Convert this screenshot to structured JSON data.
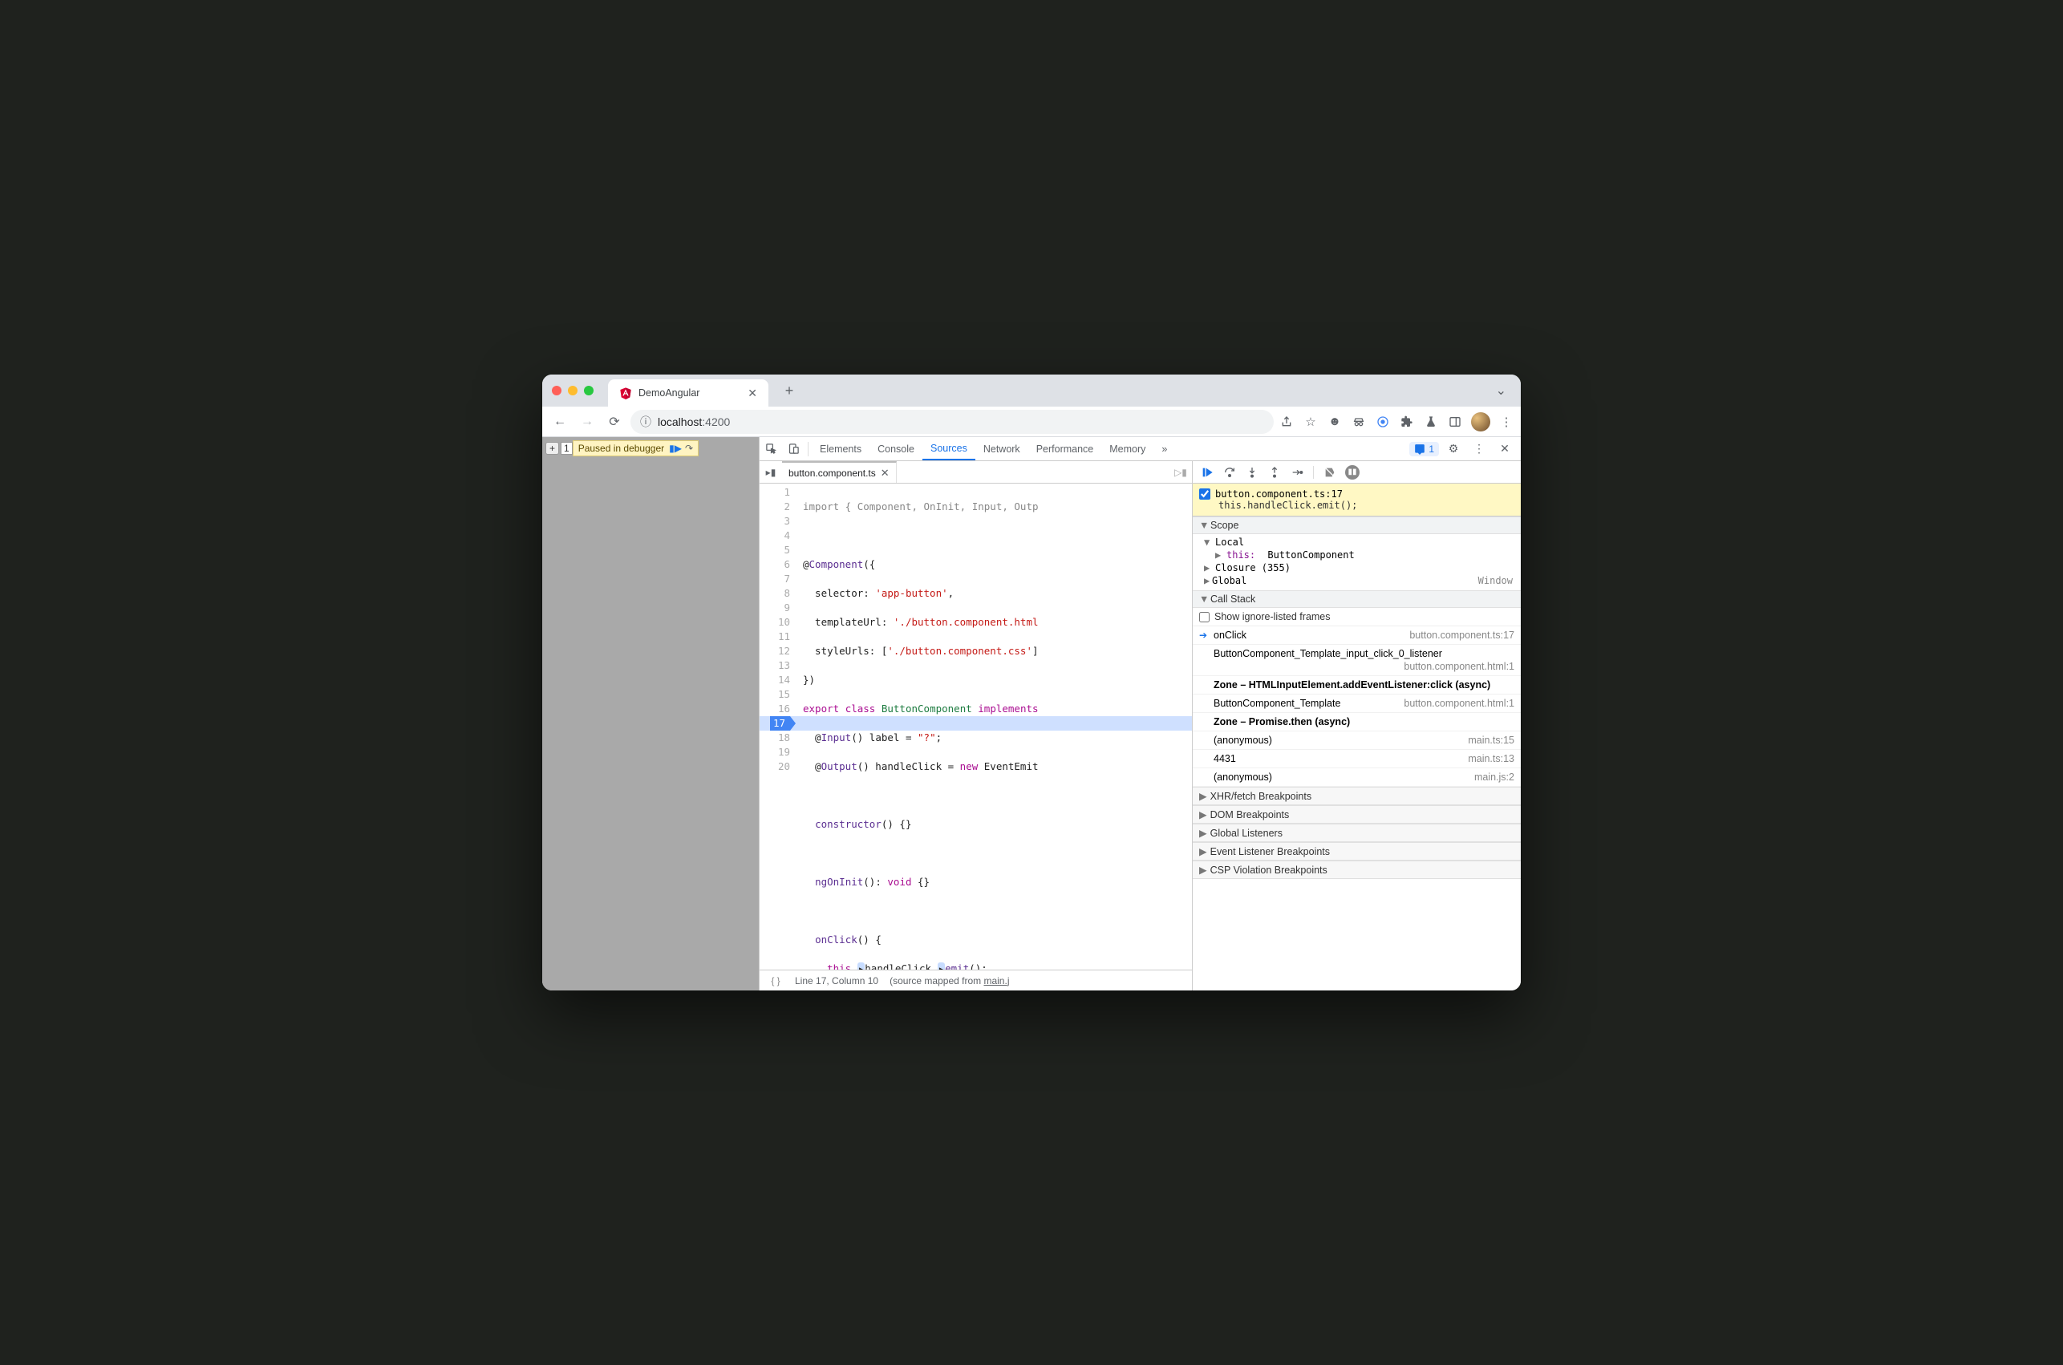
{
  "titlebar": {
    "tab_title": "DemoAngular"
  },
  "toolbar": {
    "url_host": "localhost",
    "url_port": ":4200"
  },
  "paused": {
    "label": "Paused in debugger"
  },
  "devtools_tabs": {
    "elements": "Elements",
    "console": "Console",
    "sources": "Sources",
    "network": "Network",
    "performance": "Performance",
    "memory": "Memory",
    "more": "»",
    "issues_count": "1"
  },
  "file_tab": {
    "name": "button.component.ts"
  },
  "code": {
    "lines": [
      "",
      "",
      "@Component({",
      "  selector: 'app-button',",
      "  templateUrl: './button.component.html",
      "  styleUrls: ['./button.component.css']",
      "})",
      "export class ButtonComponent implements",
      "  @Input() label = \"?\";",
      "  @Output() handleClick = new EventEmit",
      "",
      "  constructor() {}",
      "",
      "  ngOnInit(): void {}",
      "",
      "  onClick() {",
      "    this.handleClick.emit();",
      "  }",
      "}",
      ""
    ],
    "line_numbers": [
      "1",
      "2",
      "3",
      "4",
      "5",
      "6",
      "7",
      "8",
      "9",
      "10",
      "11",
      "12",
      "13",
      "14",
      "15",
      "16",
      "17",
      "18",
      "19",
      "20"
    ]
  },
  "statusbar": {
    "pretty": "{ }",
    "pos": "Line 17, Column 10",
    "mapped_prefix": "(source mapped from ",
    "mapped_link": "main.j"
  },
  "breakpoint_banner": {
    "file": "button.component.ts:17",
    "expr": "this.handleClick.emit();"
  },
  "scope": {
    "header": "Scope",
    "local": "Local",
    "this_label": "this:",
    "this_val": "ButtonComponent",
    "closure": "Closure (355)",
    "global": "Global",
    "window": "Window"
  },
  "callstack": {
    "header": "Call Stack",
    "show_ignore": "Show ignore-listed frames",
    "frames": [
      {
        "name": "onClick",
        "loc": "button.component.ts:17",
        "current": true
      },
      {
        "name": "ButtonComponent_Template_input_click_0_listener",
        "loc": "button.component.html:1"
      },
      {
        "name": "Zone – HTMLInputElement.addEventListener:click (async)",
        "async": true
      },
      {
        "name": "ButtonComponent_Template",
        "loc": "button.component.html:1"
      },
      {
        "name": "Zone – Promise.then (async)",
        "async": true
      },
      {
        "name": "(anonymous)",
        "loc": "main.ts:15"
      },
      {
        "name": "4431",
        "loc": "main.ts:13"
      },
      {
        "name": "(anonymous)",
        "loc": "main.js:2"
      }
    ]
  },
  "panels": {
    "xhr": "XHR/fetch Breakpoints",
    "dom": "DOM Breakpoints",
    "gl": "Global Listeners",
    "el": "Event Listener Breakpoints",
    "csp": "CSP Violation Breakpoints"
  }
}
